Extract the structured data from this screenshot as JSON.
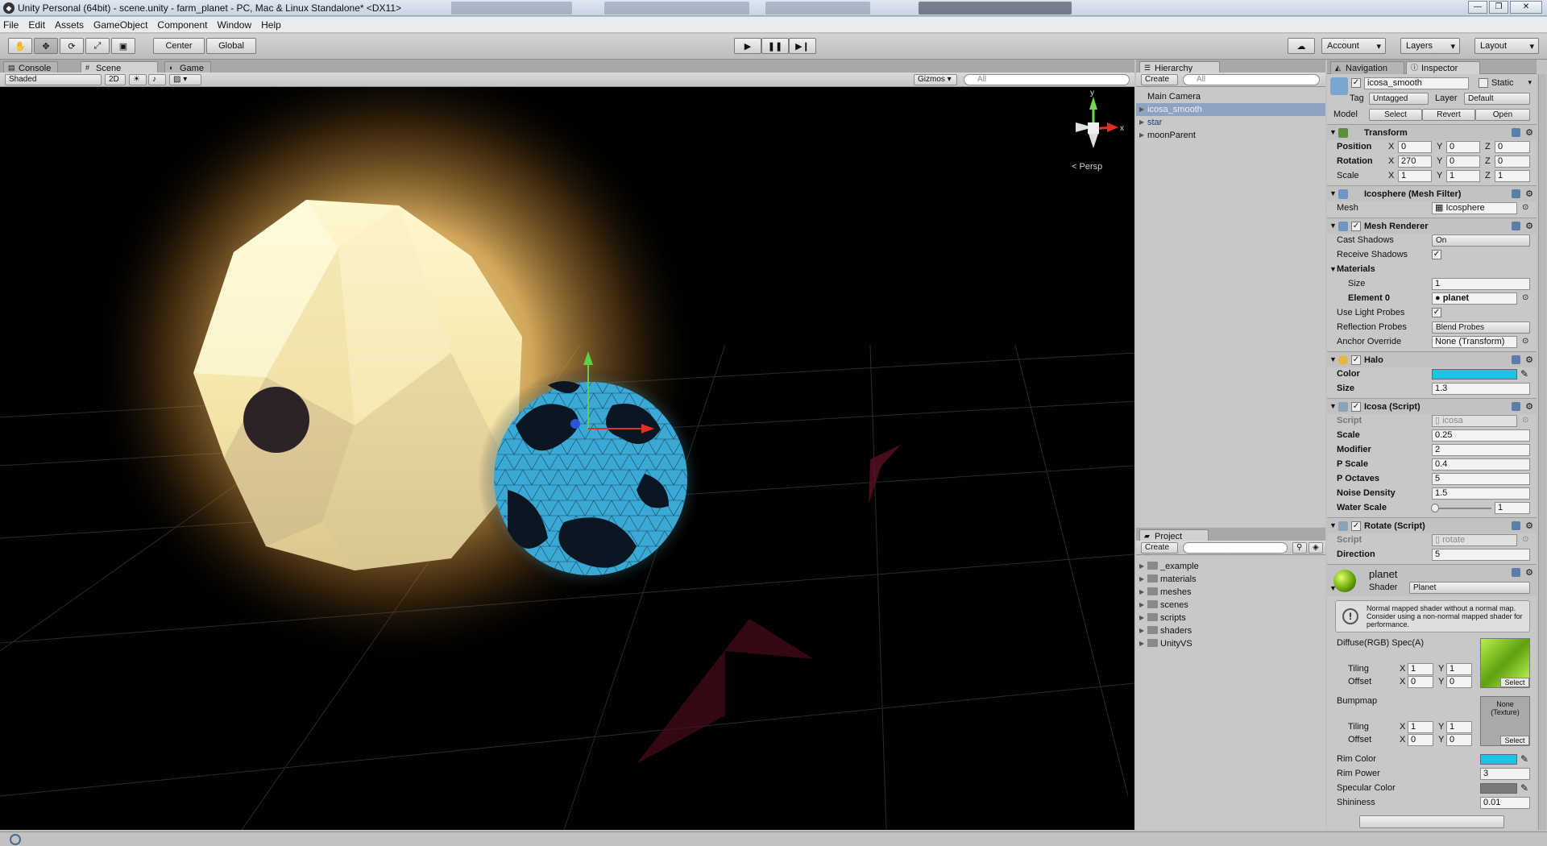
{
  "window": {
    "title": "Unity Personal (64bit) - scene.unity - farm_planet - PC, Mac & Linux Standalone* <DX11>",
    "controls": [
      "—",
      "❐",
      "✕"
    ]
  },
  "menu": [
    "File",
    "Edit",
    "Assets",
    "GameObject",
    "Component",
    "Window",
    "Help"
  ],
  "toolbar": {
    "pivot": "Center",
    "space": "Global",
    "account": "Account",
    "layers": "Layers",
    "layout": "Layout"
  },
  "scene_tabs": {
    "console": "Console",
    "scene": "Scene",
    "game": "Game",
    "shading": "Shaded",
    "mode_2d": "2D",
    "gizmos": "Gizmos",
    "search": "All",
    "persp": "Persp"
  },
  "hierarchy": {
    "tab": "Hierarchy",
    "create": "Create",
    "search": "All",
    "items": [
      {
        "label": "Main Camera"
      },
      {
        "label": "icosa_smooth"
      },
      {
        "label": "star"
      },
      {
        "label": "moonParent"
      }
    ]
  },
  "project": {
    "tab": "Project",
    "create": "Create",
    "folders": [
      "_example",
      "materials",
      "meshes",
      "scenes",
      "scripts",
      "shaders",
      "UnityVS"
    ]
  },
  "inspector_tabs": {
    "navigation": "Navigation",
    "inspector": "Inspector"
  },
  "inspector": {
    "object_name": "icosa_smooth",
    "static": "Static",
    "tag_label": "Tag",
    "tag": "Untagged",
    "layer_label": "Layer",
    "layer": "Default",
    "model_label": "Model",
    "model_select": "Select",
    "model_revert": "Revert",
    "model_open": "Open",
    "transform": {
      "title": "Transform",
      "position_label": "Position",
      "rotation_label": "Rotation",
      "scale_label": "Scale",
      "position": [
        "0",
        "0",
        "0"
      ],
      "rotation": [
        "270",
        "0",
        "0"
      ],
      "scale": [
        "1",
        "1",
        "1"
      ]
    },
    "mesh_filter": {
      "title": "Icosphere (Mesh Filter)",
      "mesh_label": "Mesh",
      "mesh": "Icosphere"
    },
    "mesh_renderer": {
      "title": "Mesh Renderer",
      "cast_shadows_label": "Cast Shadows",
      "cast_shadows": "On",
      "receive_shadows_label": "Receive Shadows",
      "materials_label": "Materials",
      "size_label": "Size",
      "size": "1",
      "element0_label": "Element 0",
      "element0": "planet",
      "light_probes_label": "Use Light Probes",
      "reflection_probes_label": "Reflection Probes",
      "reflection_probes": "Blend Probes",
      "anchor_label": "Anchor Override",
      "anchor": "None (Transform)"
    },
    "halo": {
      "title": "Halo",
      "color_label": "Color",
      "color": "#19c6e6",
      "size_label": "Size",
      "size": "1.3"
    },
    "icosa_script": {
      "title": "Icosa (Script)",
      "script_label": "Script",
      "script": "icosa",
      "fields": [
        {
          "label": "Scale",
          "value": "0.25"
        },
        {
          "label": "Modifier",
          "value": "2"
        },
        {
          "label": "P Scale",
          "value": "0.4"
        },
        {
          "label": "P Octaves",
          "value": "5"
        },
        {
          "label": "Noise Density",
          "value": "1.5"
        }
      ],
      "water_label": "Water Scale",
      "water_value": "1",
      "water_fraction": 0.05
    },
    "rotate_script": {
      "title": "Rotate (Script)",
      "script_label": "Script",
      "script": "rotate",
      "direction_label": "Direction",
      "direction": "5"
    },
    "material": {
      "name": "planet",
      "shader_label": "Shader",
      "shader": "Planet",
      "warning": "Normal mapped shader without a normal map. Consider using a non-normal mapped shader for performance.",
      "diffuse_label": "Diffuse(RGB) Spec(A)",
      "tiling_label": "Tiling",
      "offset_label": "Offset",
      "diffuse_tiling": [
        "1",
        "1"
      ],
      "diffuse_offset": [
        "0",
        "0"
      ],
      "select": "Select",
      "bumpmap_label": "Bumpmap",
      "bumpmap_none": "None (Texture)",
      "bump_tiling": [
        "1",
        "1"
      ],
      "bump_offset": [
        "0",
        "0"
      ],
      "rim_color_label": "Rim Color",
      "rim_color": "#19c6e6",
      "rim_power_label": "Rim Power",
      "rim_power": "3",
      "spec_color_label": "Specular Color",
      "spec_color": "#7a7a7a",
      "shininess_label": "Shininess",
      "shininess": "0.01"
    }
  },
  "colors": {
    "selection": "#8ea2c2",
    "scene_bg": "#000000",
    "star_glow": "#f5c46a",
    "planet": "#3aa9d6"
  }
}
